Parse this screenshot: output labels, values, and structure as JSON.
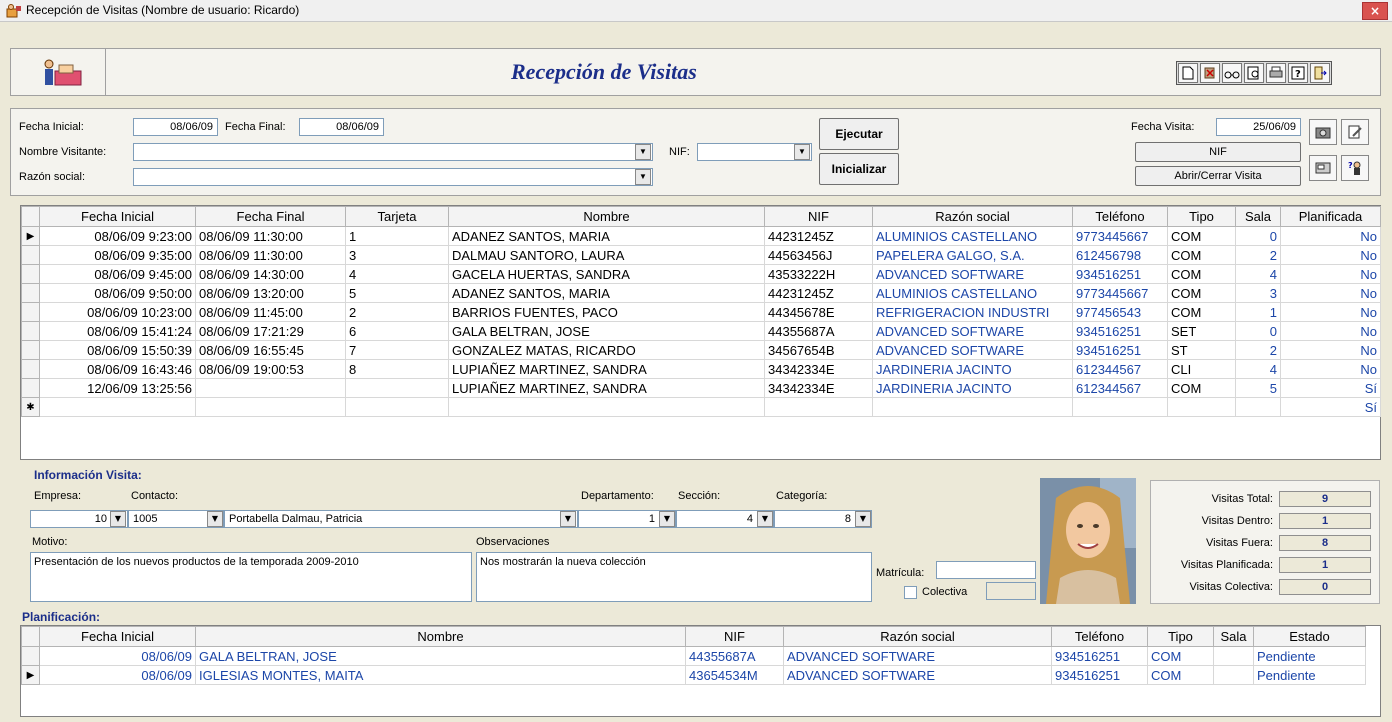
{
  "window": {
    "title": "Recepción de Visitas (Nombre de usuario: Ricardo)",
    "close_label": "×"
  },
  "header": {
    "title": "Recepción de Visitas"
  },
  "toolbar": {
    "icons": [
      "new-document-icon",
      "delete-icon",
      "view-glasses-icon",
      "preview-icon",
      "print-icon",
      "help-icon",
      "exit-icon"
    ]
  },
  "filter": {
    "fecha_inicial_label": "Fecha Inicial:",
    "fecha_inicial_value": "08/06/09",
    "fecha_final_label": "Fecha Final:",
    "fecha_final_value": "08/06/09",
    "nombre_visitante_label": "Nombre Visitante:",
    "nombre_visitante_value": "",
    "nif_label": "NIF:",
    "nif_value": "",
    "razon_social_label": "Razón social:",
    "razon_social_value": "",
    "ejecutar_label": "Ejecutar",
    "inicializar_label": "Inicializar",
    "fecha_visita_label": "Fecha Visita:",
    "fecha_visita_value": "25/06/09",
    "nif_button_label": "NIF",
    "abrir_cerrar_label": "Abrir/Cerrar Visita"
  },
  "visits_grid": {
    "columns": [
      "Fecha Inicial",
      "Fecha Final",
      "Tarjeta",
      "Nombre",
      "NIF",
      "Razón social",
      "Teléfono",
      "Tipo",
      "Sala",
      "Planificada"
    ],
    "rows": [
      {
        "marker": "▶",
        "fi": "08/06/09 9:23:00",
        "ff": "08/06/09 11:30:00",
        "tarjeta": "1",
        "nombre": "ADANEZ SANTOS, MARIA",
        "nif": "44231245Z",
        "razon": "ALUMINIOS CASTELLANO",
        "tel": "9773445667",
        "tipo": "COM",
        "sala": "0",
        "plan": "No"
      },
      {
        "marker": "",
        "fi": "08/06/09 9:35:00",
        "ff": "08/06/09 11:30:00",
        "tarjeta": "3",
        "nombre": "DALMAU SANTORO, LAURA",
        "nif": "44563456J",
        "razon": "PAPELERA GALGO, S.A.",
        "tel": "612456798",
        "tipo": "COM",
        "sala": "2",
        "plan": "No"
      },
      {
        "marker": "",
        "fi": "08/06/09 9:45:00",
        "ff": "08/06/09 14:30:00",
        "tarjeta": "4",
        "nombre": "GACELA HUERTAS, SANDRA",
        "nif": "43533222H",
        "razon": "ADVANCED SOFTWARE",
        "tel": "934516251",
        "tipo": "COM",
        "sala": "4",
        "plan": "No"
      },
      {
        "marker": "",
        "fi": "08/06/09 9:50:00",
        "ff": "08/06/09 13:20:00",
        "tarjeta": "5",
        "nombre": "ADANEZ SANTOS, MARIA",
        "nif": "44231245Z",
        "razon": "ALUMINIOS CASTELLANO",
        "tel": "9773445667",
        "tipo": "COM",
        "sala": "3",
        "plan": "No"
      },
      {
        "marker": "",
        "fi": "08/06/09 10:23:00",
        "ff": "08/06/09 11:45:00",
        "tarjeta": "2",
        "nombre": "BARRIOS FUENTES, PACO",
        "nif": "44345678E",
        "razon": "REFRIGERACION INDUSTRI",
        "tel": "977456543",
        "tipo": "COM",
        "sala": "1",
        "plan": "No"
      },
      {
        "marker": "",
        "fi": "08/06/09 15:41:24",
        "ff": "08/06/09 17:21:29",
        "tarjeta": "6",
        "nombre": "GALA BELTRAN, JOSE",
        "nif": "44355687A",
        "razon": "ADVANCED SOFTWARE",
        "tel": "934516251",
        "tipo": "SET",
        "sala": "0",
        "plan": "No"
      },
      {
        "marker": "",
        "fi": "08/06/09 15:50:39",
        "ff": "08/06/09 16:55:45",
        "tarjeta": "7",
        "nombre": "GONZALEZ MATAS, RICARDO",
        "nif": "34567654B",
        "razon": "ADVANCED SOFTWARE",
        "tel": "934516251",
        "tipo": "ST",
        "sala": "2",
        "plan": "No"
      },
      {
        "marker": "",
        "fi": "08/06/09 16:43:46",
        "ff": "08/06/09 19:00:53",
        "tarjeta": "8",
        "nombre": "LUPIAÑEZ MARTINEZ, SANDRA",
        "nif": "34342334E",
        "razon": "JARDINERIA JACINTO",
        "tel": "612344567",
        "tipo": "CLI",
        "sala": "4",
        "plan": "No"
      },
      {
        "marker": "",
        "fi": "12/06/09 13:25:56",
        "ff": "",
        "tarjeta": "",
        "nombre": "LUPIAÑEZ MARTINEZ, SANDRA",
        "nif": "34342334E",
        "razon": "JARDINERIA JACINTO",
        "tel": "612344567",
        "tipo": "COM",
        "sala": "5",
        "plan": "Sí"
      },
      {
        "marker": "✱",
        "fi": "",
        "ff": "",
        "tarjeta": "",
        "nombre": "",
        "nif": "",
        "razon": "",
        "tel": "",
        "tipo": "",
        "sala": "",
        "plan": "Sí"
      }
    ]
  },
  "info": {
    "section_title": "Información Visita:",
    "empresa_label": "Empresa:",
    "empresa_value": "10",
    "contacto_label": "Contacto:",
    "contacto_code": "1005",
    "contacto_name": "Portabella Dalmau, Patricia",
    "departamento_label": "Departamento:",
    "departamento_value": "1",
    "seccion_label": "Sección:",
    "seccion_value": "4",
    "categoria_label": "Categoría:",
    "categoria_value": "8",
    "motivo_label": "Motivo:",
    "motivo_value": "Presentación de los nuevos productos de la temporada 2009-2010",
    "observaciones_label": "Observaciones",
    "observaciones_value": "Nos mostrarán la nueva  colección",
    "matricula_label": "Matrícula:",
    "matricula_value": "",
    "colectiva_label": "Colectiva",
    "colectiva_value": ""
  },
  "stats": {
    "total_label": "Visitas Total:",
    "total_value": "9",
    "dentro_label": "Visitas Dentro:",
    "dentro_value": "1",
    "fuera_label": "Visitas Fuera:",
    "fuera_value": "8",
    "planificada_label": "Visitas Planificada:",
    "planificada_value": "1",
    "colectiva_label": "Visitas Colectiva:",
    "colectiva_value": "0"
  },
  "planning": {
    "section_title": "Planificación:",
    "columns": [
      "Fecha Inicial",
      "Nombre",
      "NIF",
      "Razón social",
      "Teléfono",
      "Tipo",
      "Sala",
      "Estado"
    ],
    "rows": [
      {
        "marker": "",
        "fi": "08/06/09",
        "nombre": "GALA BELTRAN, JOSE",
        "nif": "44355687A",
        "razon": "ADVANCED SOFTWARE",
        "tel": "934516251",
        "tipo": "COM",
        "sala": "",
        "estado": "Pendiente"
      },
      {
        "marker": "▶",
        "fi": "08/06/09",
        "nombre": "IGLESIAS MONTES, MAITA",
        "nif": "43654534M",
        "razon": "ADVANCED SOFTWARE",
        "tel": "934516251",
        "tipo": "COM",
        "sala": "",
        "estado": "Pendiente"
      }
    ]
  },
  "colors": {
    "accent": "#1b2e8a",
    "link": "#1c46a8",
    "background": "#ECE9D8"
  }
}
